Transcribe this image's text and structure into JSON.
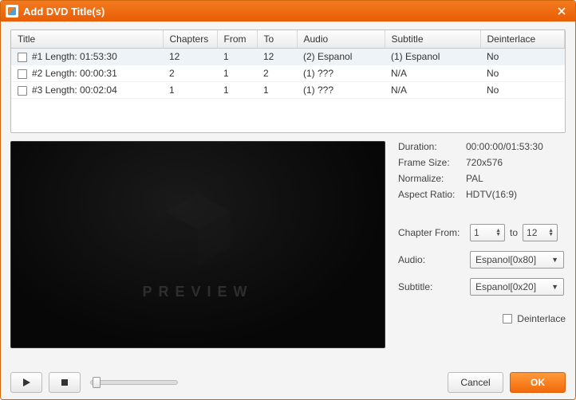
{
  "window": {
    "title": "Add DVD Title(s)"
  },
  "table": {
    "columns": [
      "Title",
      "Chapters",
      "From",
      "To",
      "Audio",
      "Subtitle",
      "Deinterlace"
    ],
    "rows": [
      {
        "selected": true,
        "title": "#1 Length: 01:53:30",
        "chapters": "12",
        "from": "1",
        "to": "12",
        "audio": "(2) Espanol",
        "subtitle": "(1) Espanol",
        "deinterlace": "No"
      },
      {
        "selected": false,
        "title": "#2 Length: 00:00:31",
        "chapters": "2",
        "from": "1",
        "to": "2",
        "audio": "(1) ???",
        "subtitle": "N/A",
        "deinterlace": "No"
      },
      {
        "selected": false,
        "title": "#3 Length: 00:02:04",
        "chapters": "1",
        "from": "1",
        "to": "1",
        "audio": "(1) ???",
        "subtitle": "N/A",
        "deinterlace": "No"
      }
    ]
  },
  "preview": {
    "label": "PREVIEW"
  },
  "info": {
    "duration_label": "Duration:",
    "duration": "00:00:00/01:53:30",
    "frame_size_label": "Frame Size:",
    "frame_size": "720x576",
    "normalize_label": "Normalize:",
    "normalize": "PAL",
    "aspect_label": "Aspect Ratio:",
    "aspect": "HDTV(16:9)"
  },
  "controls": {
    "chapter_from_label": "Chapter From:",
    "chapter_from": "1",
    "to_label": "to",
    "chapter_to": "12",
    "audio_label": "Audio:",
    "audio_value": "Espanol[0x80]",
    "subtitle_label": "Subtitle:",
    "subtitle_value": "Espanol[0x20]",
    "deinterlace_label": "Deinterlace"
  },
  "buttons": {
    "cancel": "Cancel",
    "ok": "OK"
  }
}
